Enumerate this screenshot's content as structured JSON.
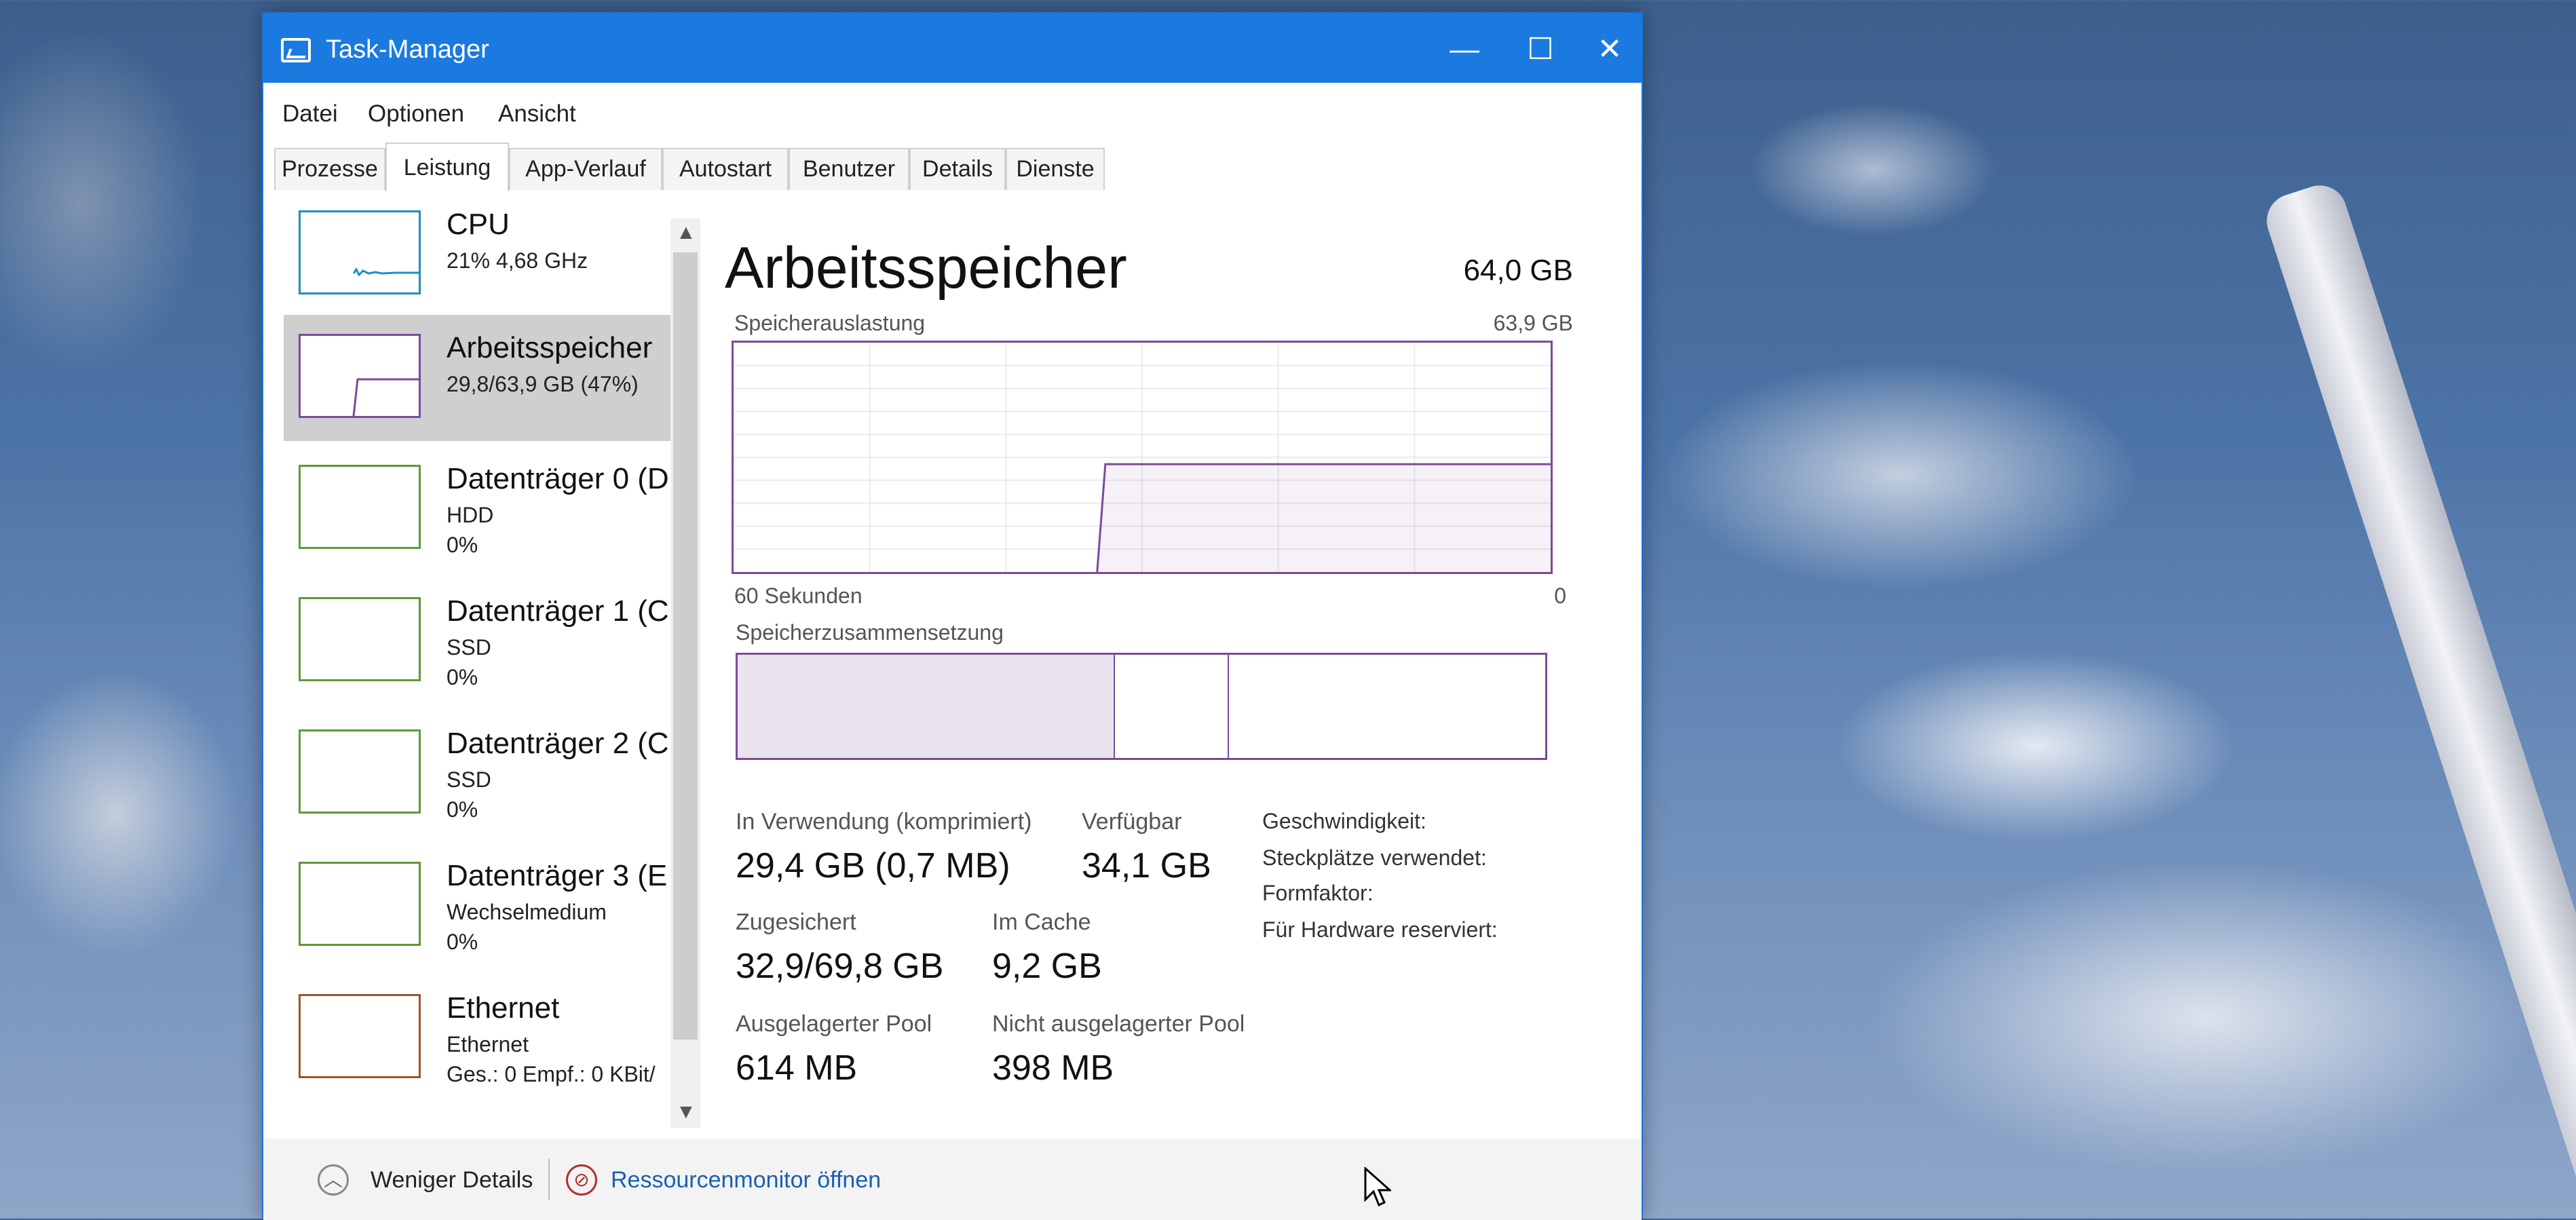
{
  "window": {
    "title": "Task-Manager",
    "controls": {
      "minimize": "—",
      "maximize": "☐",
      "close": "✕"
    }
  },
  "menu": [
    "Datei",
    "Optionen",
    "Ansicht"
  ],
  "tabs": [
    {
      "label": "Prozesse",
      "active": false
    },
    {
      "label": "Leistung",
      "active": true
    },
    {
      "label": "App-Verlauf",
      "active": false
    },
    {
      "label": "Autostart",
      "active": false
    },
    {
      "label": "Benutzer",
      "active": false
    },
    {
      "label": "Details",
      "active": false
    },
    {
      "label": "Dienste",
      "active": false
    }
  ],
  "sidebar": {
    "items": [
      {
        "name": "CPU",
        "sub": "21% 4,68 GHz",
        "sub2": "",
        "color": "#1f8fbf",
        "selected": false
      },
      {
        "name": "Arbeitsspeicher",
        "sub": "29,8/63,9 GB (47%)",
        "sub2": "",
        "color": "#7a4b9a",
        "selected": true
      },
      {
        "name": "Datenträger 0 (D",
        "sub": "HDD",
        "sub2": "0%",
        "color": "#5b9a3a",
        "selected": false
      },
      {
        "name": "Datenträger 1 (C",
        "sub": "SSD",
        "sub2": "0%",
        "color": "#5b9a3a",
        "selected": false
      },
      {
        "name": "Datenträger 2 (C",
        "sub": "SSD",
        "sub2": "0%",
        "color": "#5b9a3a",
        "selected": false
      },
      {
        "name": "Datenträger 3 (E",
        "sub": "Wechselmedium",
        "sub2": "0%",
        "color": "#5b9a3a",
        "selected": false
      },
      {
        "name": "Ethernet",
        "sub": "Ethernet",
        "sub2": "Ges.: 0 Empf.: 0 KBit/",
        "color": "#a0522d",
        "selected": false
      }
    ]
  },
  "main": {
    "title": "Arbeitsspeicher",
    "total": "64,0 GB",
    "usage_label": "Speicherauslastung",
    "usage_max": "63,9 GB",
    "time_left": "60 Sekunden",
    "time_right": "0",
    "usage_fraction_end": 0.47,
    "composition_label": "Speicherzusammensetzung",
    "stats": {
      "in_use_label": "In Verwendung (komprimiert)",
      "in_use_value": "29,4 GB (0,7 MB)",
      "available_label": "Verfügbar",
      "available_value": "34,1 GB",
      "committed_label": "Zugesichert",
      "committed_value": "32,9/69,8 GB",
      "cached_label": "Im Cache",
      "cached_value": "9,2 GB",
      "paged_label": "Ausgelagerter Pool",
      "paged_value": "614 MB",
      "nonpaged_label": "Nicht ausgelagerter Pool",
      "nonpaged_value": "398 MB"
    },
    "right_labels": [
      "Geschwindigkeit:",
      "Steckplätze verwendet:",
      "Formfaktor:",
      "Für Hardware reserviert:"
    ]
  },
  "footer": {
    "less_details": "Weniger Details",
    "resource_monitor": "Ressourcenmonitor öffnen",
    "link_color": "#1a5fb4"
  },
  "colors": {
    "titlebar": "#1a7ae0",
    "memory_accent": "#7a4b9a"
  }
}
